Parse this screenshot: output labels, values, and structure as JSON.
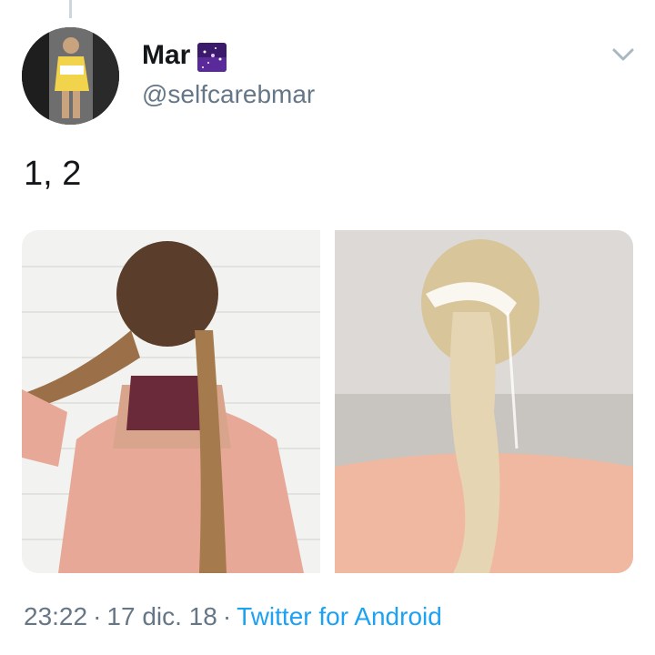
{
  "user": {
    "display_name": "Mar",
    "handle": "@selfcarebmar",
    "badge_icon": "galaxy-emoji"
  },
  "tweet": {
    "text": "1, 2",
    "time": "23:22",
    "date": "17 dic. 18",
    "separator": "·",
    "source": "Twitter for Android"
  },
  "colors": {
    "text": "#14171a",
    "muted": "#657786",
    "link": "#1da1f2"
  }
}
